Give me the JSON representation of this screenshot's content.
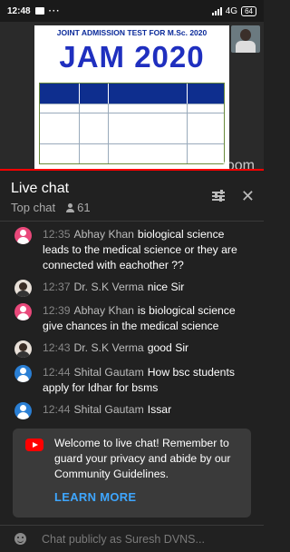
{
  "status_bar": {
    "time": "12:48",
    "dots": "···",
    "network": "4G",
    "battery": "64"
  },
  "video": {
    "slide_subtitle": "JOINT ADMISSION TEST FOR M.Sc. 2020",
    "slide_title": "JAM 2020",
    "watermark": "zoom",
    "progress_fraction": 1.0
  },
  "chat": {
    "title": "Live chat",
    "mode": "Top chat",
    "viewer_count": "61",
    "messages": [
      {
        "time": "12:35",
        "author": "Abhay Khan",
        "text": "biological science leads to the medical science or they are connected with eachother ??",
        "avatar": "pink-person-avatar"
      },
      {
        "time": "12:37",
        "author": "Dr. S.K Verma",
        "text": "nice Sir",
        "avatar": "photo-avatar"
      },
      {
        "time": "12:39",
        "author": "Abhay Khan",
        "text": "is biological science give chances in the medical science",
        "avatar": "pink-person-avatar"
      },
      {
        "time": "12:43",
        "author": "Dr. S.K Verma",
        "text": "good Sir",
        "avatar": "photo-avatar"
      },
      {
        "time": "12:44",
        "author": "Shital Gautam",
        "text": "How bsc students apply for ldhar for bsms",
        "avatar": "blue-person-avatar"
      },
      {
        "time": "12:44",
        "author": "Shital Gautam",
        "text": "Issar",
        "avatar": "blue-person-avatar"
      }
    ],
    "notice": {
      "text": "Welcome to live chat! Remember to guard your privacy and abide by our Community Guidelines.",
      "action": "LEARN MORE"
    },
    "input_placeholder": "Chat publicly as Suresh DVNS..."
  },
  "colors": {
    "background": "#212121",
    "accent_link": "#3ea6ff",
    "progress": "#ff0000"
  }
}
